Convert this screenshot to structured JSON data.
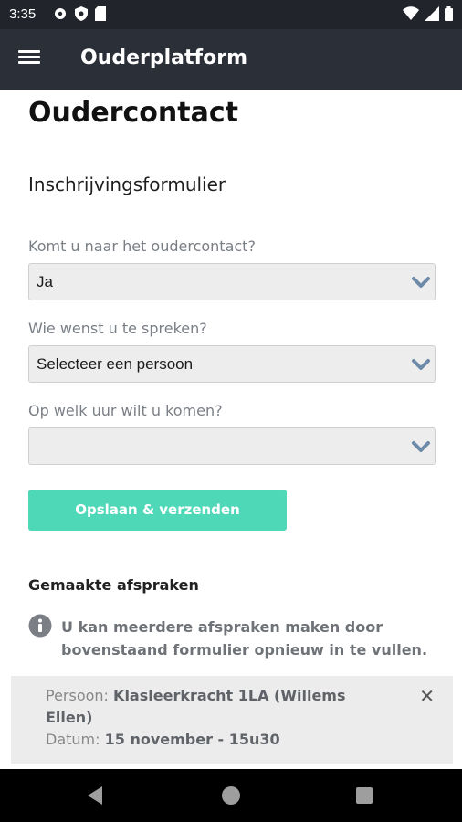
{
  "status_bar": {
    "time": "3:35",
    "icons_left": [
      "settings-icon",
      "shield-icon",
      "sd-card-icon"
    ],
    "icons_right": [
      "wifi-icon",
      "signal-icon",
      "battery-icon"
    ]
  },
  "app_bar": {
    "title": "Ouderplatform",
    "background": "#2b2f38"
  },
  "page": {
    "title": "Oudercontact",
    "form_title": "Inschrijvingsformulier"
  },
  "form": {
    "q1": {
      "label": "Komt u naar het oudercontact?",
      "value": "Ja"
    },
    "q2": {
      "label": "Wie wenst u te spreken?",
      "value": "Selecteer een persoon"
    },
    "q3": {
      "label": "Op welk uur wilt u komen?",
      "value": ""
    },
    "submit_label": "Opslaan & verzenden",
    "submit_color": "#4fd8b8"
  },
  "appointments": {
    "title": "Gemaakte afspraken",
    "info": "U kan meerdere afspraken maken door bovenstaand formulier opnieuw in te vullen.",
    "items": [
      {
        "person_label": "Persoon:",
        "person_value": "Klasleerkracht 1LA (Willems Ellen)",
        "date_label": "Datum:",
        "date_value": "15 november - 15u30"
      }
    ]
  }
}
